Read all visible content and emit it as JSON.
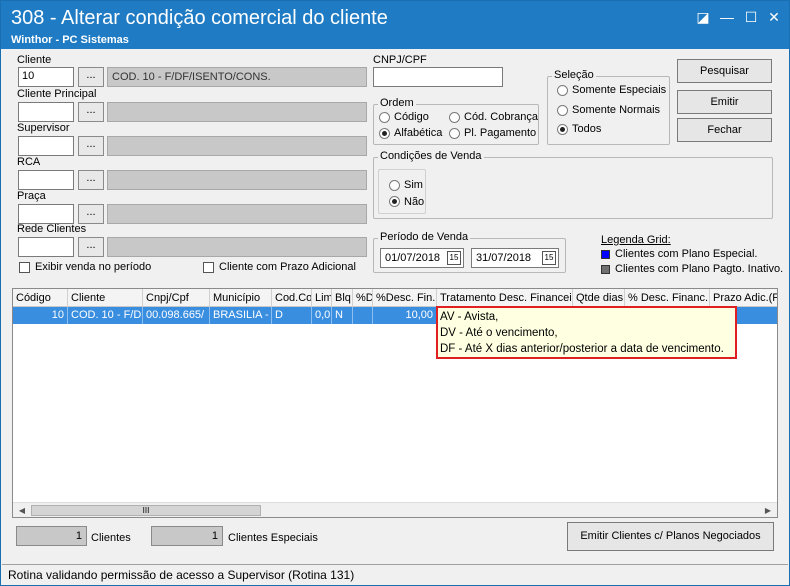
{
  "window": {
    "title": "308 - Alterar condição comercial do cliente",
    "subtitle": "Winthor - PC Sistemas",
    "controls": {
      "restore": "◪",
      "minimize": "—",
      "maximize": "☐",
      "close": "✕"
    }
  },
  "filters": {
    "cliente_label": "Cliente",
    "cliente_code": "10",
    "cliente_desc": "COD. 10 - F/DF/ISENTO/CONS.",
    "cliente_principal_label": "Cliente Principal",
    "supervisor_label": "Supervisor",
    "rca_label": "RCA",
    "praca_label": "Praça",
    "rede_label": "Rede Clientes",
    "lookup_button": "...",
    "exibir_venda_label": "Exibir venda no período",
    "prazo_adicional_label": "Cliente com Prazo Adicional",
    "cnpj_label": "CNPJ/CPF",
    "cnpj_value": ""
  },
  "ordem": {
    "title": "Ordem",
    "codigo": "Código",
    "alfabetica": "Alfabética",
    "cod_cobranca": "Cód. Cobrança",
    "pl_pagamento": "Pl. Pagamento",
    "selected": "Alfabética"
  },
  "selecao": {
    "title": "Seleção",
    "especiais": "Somente Especiais",
    "normais": "Somente Normais",
    "todos": "Todos",
    "selected": "Todos"
  },
  "condicoes": {
    "title": "Condições de Venda",
    "sim": "Sim",
    "nao": "Não",
    "selected": "Não"
  },
  "periodo": {
    "title": "Período de Venda",
    "start": "01/07/2018",
    "end": "31/07/2018",
    "cal_icon": "15"
  },
  "legenda": {
    "title": "Legenda Grid:",
    "especial": "Clientes com Plano Especial.",
    "inativo": "Clientes com Plano Pagto. Inativo.",
    "especial_color": "#0000ff",
    "inativo_color": "#707070"
  },
  "buttons": {
    "pesquisar": "Pesquisar",
    "emitir": "Emitir",
    "fechar": "Fechar",
    "emitir_planos": "Emitir Clientes c/ Planos Negociados"
  },
  "grid": {
    "columns": [
      "Código",
      "Cliente",
      "Cnpj/Cpf",
      "Município",
      "Cod.Co",
      "Lim",
      "Blq",
      "%D",
      "%Desc. Fin.",
      "Tratamento Desc. Financeir",
      "Qtde dias",
      "% Desc. Financ.",
      "Prazo Adic.(F"
    ],
    "rows": [
      [
        "10",
        "COD. 10 - F/DF",
        "00.098.665/",
        "BRASILIA - I",
        "D",
        "0,0",
        "N",
        "",
        "10,00",
        "",
        "",
        "",
        ""
      ]
    ]
  },
  "tooltip": {
    "lines": [
      "AV - Avista,",
      "DV - Até o vencimento,",
      "DF - Até X dias anterior/posterior a data de vencimento."
    ]
  },
  "scrollbar": {
    "thumb": "III",
    "left": "◀",
    "right": "▶"
  },
  "counts": {
    "clientes_count": "1",
    "clientes_label": "Clientes",
    "especiais_count": "1",
    "especiais_label": "Clientes Especiais"
  },
  "status": "Rotina validando permissão de acesso a Supervisor (Rotina 131)"
}
